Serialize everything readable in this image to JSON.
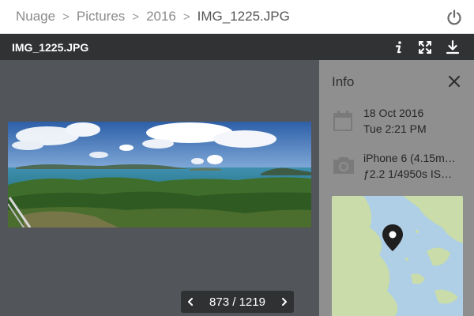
{
  "breadcrumb": {
    "items": [
      "Nuage",
      "Pictures",
      "2016"
    ],
    "current": "IMG_1225.JPG"
  },
  "header": {
    "power_icon": "power-icon"
  },
  "photo_bar": {
    "filename": "IMG_1225.JPG",
    "icons": [
      "info-icon",
      "fullscreen-icon",
      "download-icon"
    ]
  },
  "viewer": {
    "image_description": "panorama",
    "pager": {
      "current": 873,
      "total": 1219,
      "text": "873 / 1219"
    }
  },
  "info_panel": {
    "title": "Info",
    "date": "18 Oct 2016",
    "time": "Tue 2:21 PM",
    "camera": "iPhone 6 (4.15m…",
    "exposure": "ƒ2.2 1/4950s IS…",
    "icons": [
      "calendar-icon",
      "camera-icon",
      "map-pin-icon",
      "close-icon"
    ]
  },
  "colors": {
    "header_bg": "#ffffff",
    "photobar_bg": "#303234",
    "viewer_bg": "#525559",
    "panel_bg": "#8f8f8f",
    "map_water": "#aecfe6",
    "map_land": "#c9dca9"
  }
}
